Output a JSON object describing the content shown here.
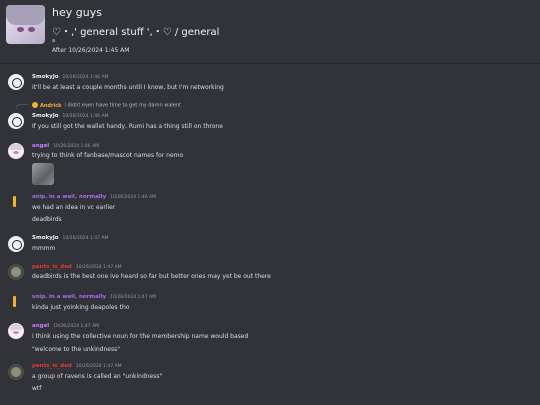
{
  "header": {
    "title": "hey guys",
    "subtitle": "♡・,' general stuff ',・♡ / general",
    "tiny": "a",
    "after": "After 10/26/2024 1:45 AM"
  },
  "messages": [
    {
      "name": "SmokyJo",
      "ts": "10/26/2024 1:46 AM",
      "lines": [
        "it'll be at least a couple months until I know, but I'm networking"
      ]
    },
    {
      "reply": {
        "name": "Andrick",
        "text": "i didnt even have time to get my damn walent"
      },
      "name": "SmokyJo",
      "ts": "10/26/2024 1:46 AM",
      "lines": [
        "If you still got the wallet handy, Rumi has a thing still on throne"
      ]
    },
    {
      "name": "angel",
      "ts": "10/26/2024 1:46 AM",
      "lines": [
        "trying to think of fanbase/mascot names for nemo"
      ]
    },
    {
      "name": "snip. in a well, normally",
      "ts": "10/26/2024 1:46 AM",
      "lines": [
        "we had an idea in vc earlier",
        "deadbirds"
      ]
    },
    {
      "name": "SmokyJo",
      "ts": "10/26/2024 1:47 AM",
      "lines": [
        "mmmm"
      ]
    },
    {
      "name": "pants_is_ded",
      "ts": "10/26/2024 1:47 AM",
      "lines": [
        "deadbirds is the best one ive heard so far but better ones may yet be out there"
      ]
    },
    {
      "name": "snip. in a well, normally",
      "ts": "10/26/2024 1:47 AM",
      "lines": [
        "kinda just yoinking deapoles tho"
      ]
    },
    {
      "name": "angel",
      "ts": "10/26/2024 1:47 AM",
      "lines": [
        "i think using the collective noun for the membership name would based",
        "\"welcome to the unkindness\""
      ]
    },
    {
      "name": "pants_is_ded",
      "ts": "10/26/2024 1:47 AM",
      "lines": [
        "a group of ravens is called an \"unkindness\"",
        "wtf"
      ]
    }
  ]
}
